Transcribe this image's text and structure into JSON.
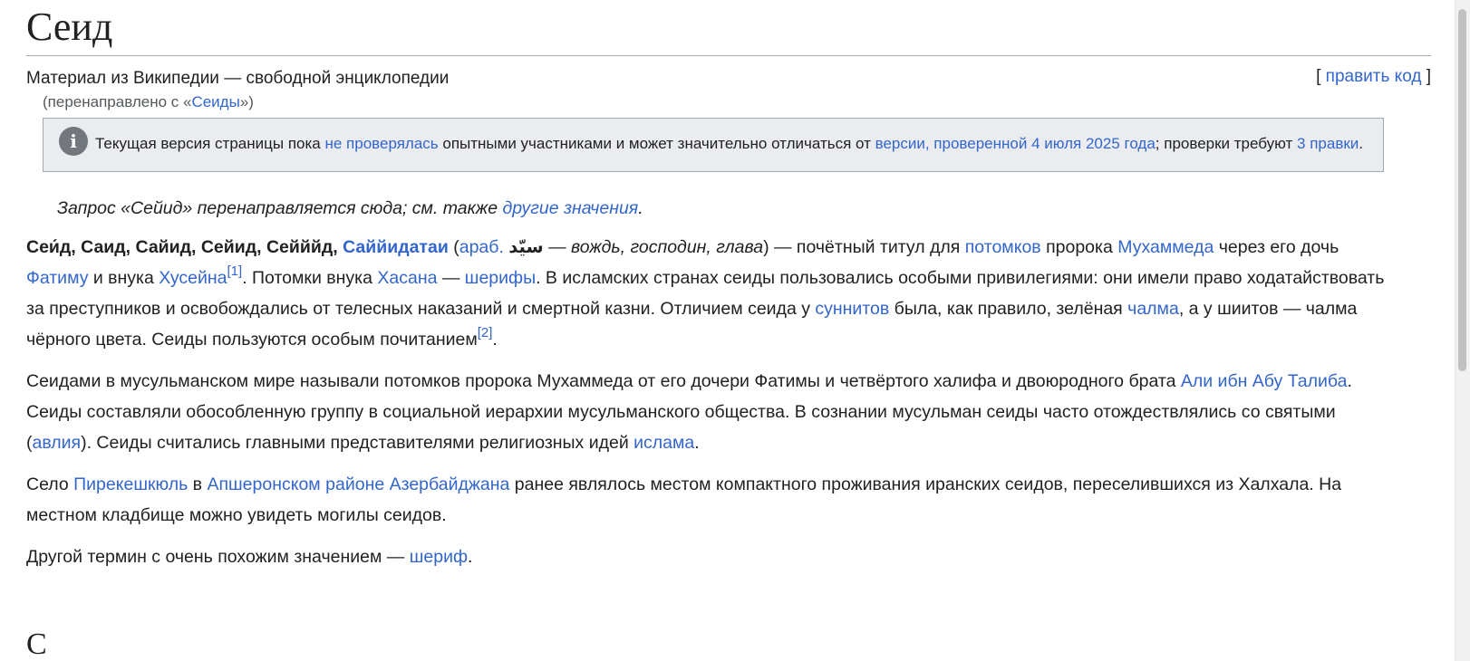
{
  "title": "Сеид",
  "site_sub": "Материал из Википедии — свободной энциклопедии",
  "edit": {
    "open": "[ ",
    "label": "править код",
    "close": " ]"
  },
  "redirect": {
    "prefix": "(перенаправлено с «",
    "link": "Сеиды",
    "suffix": "»)"
  },
  "notice": {
    "icon_name": "info-icon",
    "icon_glyph": "i",
    "t1": "Текущая версия страницы пока ",
    "l1": "не проверялась",
    "t2": " опытными участниками и может значительно отличаться от ",
    "l2": "версии, проверенной 4 июля 2025 года",
    "t3": "; проверки требуют ",
    "l3": "3 правки",
    "t4": "."
  },
  "hatnote": {
    "t1": "Запрос «Сейид» перенаправляется сюда; см. также ",
    "l1": "другие значения",
    "t2": "."
  },
  "p1": {
    "b1": "Сеи́д, Саид, Сайид, Сейид, Сейййд,",
    "l_bold": "Саййидатаи",
    "t0": " (",
    "l_arab": "араб.",
    "t_sp": " ",
    "arabic": "سيّد",
    "t_it": " — вождь, господин, глава",
    "t1": ") — почётный титул для ",
    "l1": "потомков",
    "t2": " пророка ",
    "l2": "Мухаммеда",
    "t3": " через его дочь ",
    "l3": "Фатиму",
    "t4": " и внука ",
    "l4": "Хусейна",
    "ref1": "[1]",
    "t5": ". Потомки внука ",
    "l5": "Хасана",
    "t6": " — ",
    "l6": "шерифы",
    "t7": ". В исламских странах сеиды пользовались особыми привилегиями: они имели право ходатайствовать за преступников и освобождались от телесных наказаний и смертной казни. Отличием сеида у ",
    "l7": "суннитов",
    "t8": " была, как правило, зелёная ",
    "l8": "чалма",
    "t9": ", а у шиитов — чалма чёрного цвета. Сеиды пользуются особым почитанием",
    "ref2": "[2]",
    "t10": "."
  },
  "p2": {
    "t1": "Сеидами в мусульманском мире называли потомков пророка Мухаммеда от его дочери Фатимы и четвёртого халифа и двоюродного брата ",
    "l1": "Али ибн Абу Талиба",
    "t2": ". Сеиды составляли обособленную группу в социальной иерархии мусульманского общества. В сознании мусульман сеиды часто отождествлялись со святыми (",
    "l2": "авлия",
    "t3": "). Сеиды считались главными представителями религиозных идей ",
    "l3": "ислама",
    "t4": "."
  },
  "p3": {
    "t1": "Село ",
    "l1": "Пирекешкюль",
    "t2": " в ",
    "l2": "Апшеронском районе Азербайджана",
    "t3": " ранее являлось местом компактного проживания иранских сеидов, переселившихся из Халхала. На местном кладбище можно увидеть могилы сеидов."
  },
  "p4": {
    "t1": "Другой термин с очень похожим значением — ",
    "l1": "шериф",
    "t2": "."
  },
  "next_heading": "С",
  "colors": {
    "link": "#3366cc",
    "visited": "#0b0080",
    "notice_bg": "#eaecf0",
    "border": "#a2a9b1"
  }
}
